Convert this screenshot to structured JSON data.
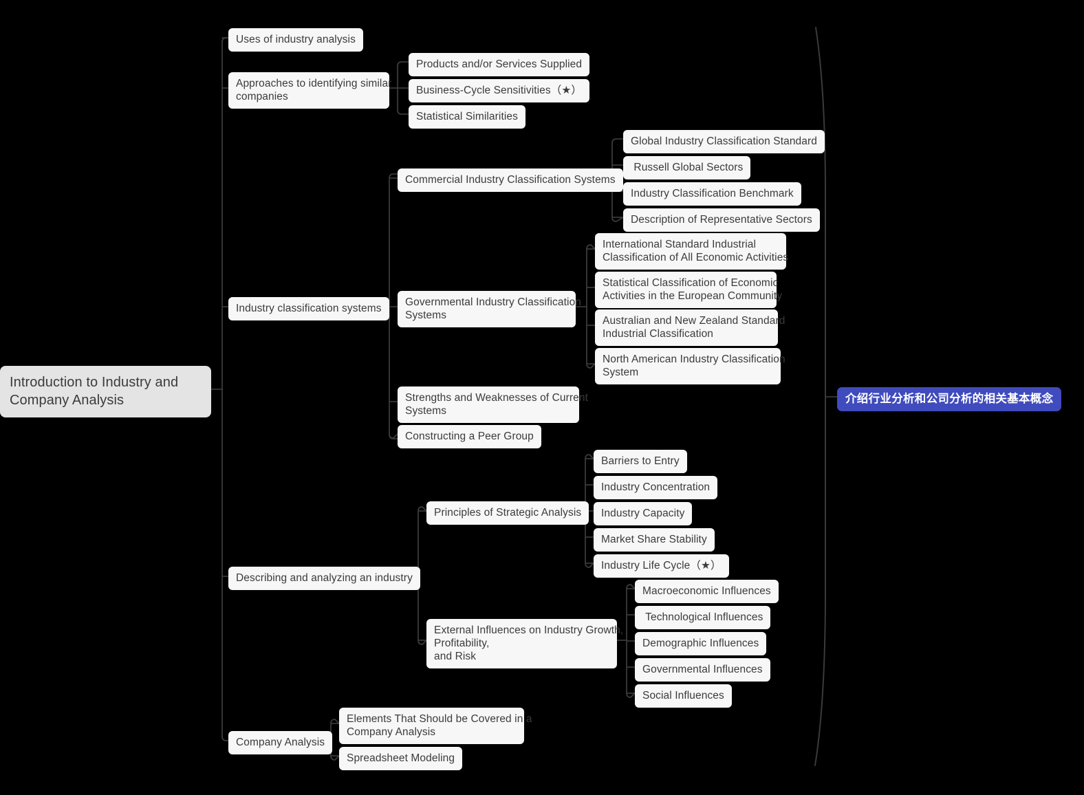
{
  "mindmap": {
    "title": "Introduction to Industry and Company Analysis",
    "background_color": "#000000",
    "node_color": "#f7f7f7",
    "root_color": "#e4e4e4",
    "badge_color": "#404bbd",
    "edge_color": "#3a3a3a",
    "text_color": "#3b3b3b",
    "root": {
      "label": "Introduction to Industry and\nCompany Analysis"
    },
    "summary_badge": {
      "label": "介绍行业分析和公司分析的相关基本概念"
    },
    "branches": [
      {
        "label": "Uses of industry analysis",
        "children": []
      },
      {
        "label": "Approaches to identifying similar\ncompanies",
        "children": [
          {
            "label": "Products and/or Services Supplied"
          },
          {
            "label": "Business-Cycle Sensitivities（★）"
          },
          {
            "label": "Statistical Similarities"
          }
        ]
      },
      {
        "label": "Industry classification systems",
        "children": [
          {
            "label": "Commercial Industry Classification Systems",
            "children": [
              {
                "label": "Global Industry Classification Standard"
              },
              {
                "label": " Russell Global Sectors"
              },
              {
                "label": "Industry Classification Benchmark"
              },
              {
                "label": "Description of Representative Sectors"
              }
            ]
          },
          {
            "label": "Governmental Industry Classification\nSystems",
            "children": [
              {
                "label": "International Standard Industrial\nClassification of All Economic Activities"
              },
              {
                "label": "Statistical Classification of Economic\nActivities in the European Community"
              },
              {
                "label": "Australian and New Zealand Standard\nIndustrial Classification"
              },
              {
                "label": "North American Industry Classification\nSystem"
              }
            ]
          },
          {
            "label": "Strengths and Weaknesses of Current\nSystems",
            "children": []
          },
          {
            "label": "Constructing a Peer Group",
            "children": []
          }
        ]
      },
      {
        "label": "Describing and analyzing an industry",
        "children": [
          {
            "label": "Principles of Strategic Analysis",
            "children": [
              {
                "label": "Barriers to Entry"
              },
              {
                "label": "Industry Concentration"
              },
              {
                "label": "Industry Capacity"
              },
              {
                "label": "Market Share Stability"
              },
              {
                "label": "Industry Life Cycle（★）"
              }
            ]
          },
          {
            "label": "External Influences on Industry Growth,\nProfitability,\nand Risk",
            "children": [
              {
                "label": "Macroeconomic Influences"
              },
              {
                "label": " Technological Influences"
              },
              {
                "label": "Demographic Influences"
              },
              {
                "label": "Governmental Influences"
              },
              {
                "label": "Social Influences"
              }
            ]
          }
        ]
      },
      {
        "label": "Company Analysis",
        "children": [
          {
            "label": "Elements That Should be Covered in a\nCompany Analysis"
          },
          {
            "label": "Spreadsheet Modeling"
          }
        ]
      }
    ]
  }
}
